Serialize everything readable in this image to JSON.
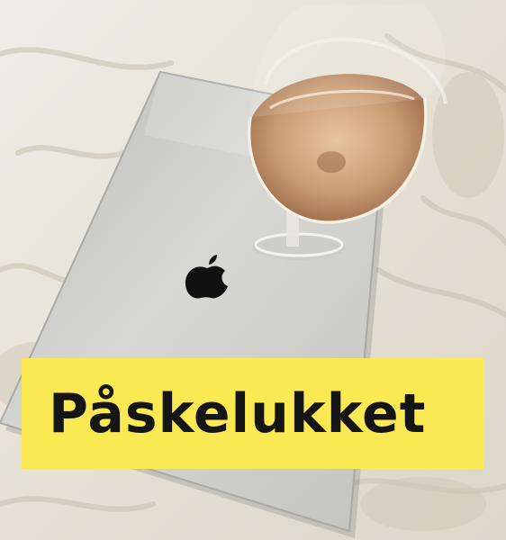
{
  "banner": {
    "text": "Påskelukket",
    "background_color": "#fbe954",
    "text_color": "#151515"
  },
  "photo": {
    "objects": [
      "bed-sheet",
      "laptop",
      "apple-logo-icon",
      "wine-glass"
    ]
  }
}
